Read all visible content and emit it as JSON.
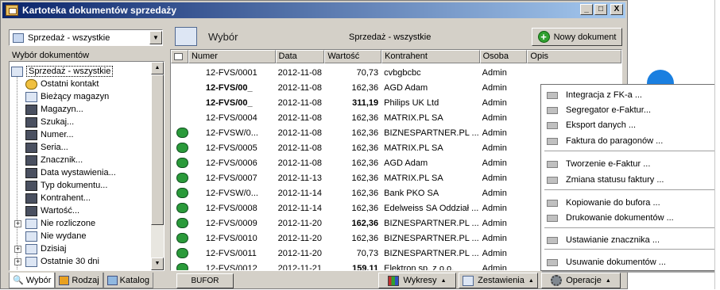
{
  "window": {
    "title": "Kartoteka dokumentów sprzedaży",
    "btn_min": "_",
    "btn_max": "□",
    "btn_close": "X"
  },
  "left": {
    "combo_value": "Sprzedaż - wszystkie",
    "section_label": "Wybór dokumentów",
    "tree": [
      {
        "label": "Sprzedaż - wszystkie",
        "icon": "list-icon",
        "selected": true
      },
      {
        "label": "Ostatni kontakt",
        "icon": "clock-icon"
      },
      {
        "label": "Bieżący magazyn",
        "icon": "list-icon"
      },
      {
        "label": "Magazyn...",
        "icon": "binoculars-icon"
      },
      {
        "label": "Szukaj...",
        "icon": "binoculars-icon"
      },
      {
        "label": "Numer...",
        "icon": "binoculars-icon"
      },
      {
        "label": "Seria...",
        "icon": "binoculars-icon"
      },
      {
        "label": "Znacznik...",
        "icon": "binoculars-icon"
      },
      {
        "label": "Data wystawienia...",
        "icon": "binoculars-icon"
      },
      {
        "label": "Typ dokumentu...",
        "icon": "binoculars-icon"
      },
      {
        "label": "Kontrahent...",
        "icon": "binoculars-icon"
      },
      {
        "label": "Wartość...",
        "icon": "binoculars-icon"
      },
      {
        "label": "Nie rozliczone",
        "icon": "list-icon",
        "expandable": true
      },
      {
        "label": "Nie wydane",
        "icon": "list-icon"
      },
      {
        "label": "Dzisiaj",
        "icon": "list-icon",
        "expandable": true
      },
      {
        "label": "Ostatnie 30 dni",
        "icon": "list-icon",
        "expandable": true
      }
    ],
    "tabs": [
      "Wybór",
      "Rodzaj",
      "Katalog"
    ]
  },
  "main": {
    "header_title": "Wybór",
    "context": "Sprzedaż - wszystkie",
    "new_doc": "Nowy dokument",
    "columns": [
      "Numer",
      "Data",
      "Wartość",
      "Kontrahent",
      "Osoba",
      "Opis"
    ],
    "rows": [
      {
        "numer": "12-FVS/0001",
        "data": "2012-11-08",
        "wartosc": "70,73",
        "kontrahent": "cvbgbcbc",
        "osoba": "Admin",
        "bold": false,
        "icon": false
      },
      {
        "numer": "12-FVS/00_",
        "data": "2012-11-08",
        "wartosc": "162,36",
        "kontrahent": "AGD Adam",
        "osoba": "Admin",
        "bold": true,
        "icon": false
      },
      {
        "numer": "12-FVS/00_",
        "data": "2012-11-08",
        "wartosc": "311,19",
        "kontrahent": "Philips UK Ltd",
        "osoba": "Admin",
        "bold": true,
        "icon": false
      },
      {
        "numer": "12-FVS/0004",
        "data": "2012-11-08",
        "wartosc": "162,36",
        "kontrahent": "MATRIX.PL SA",
        "osoba": "Admin",
        "bold": false,
        "icon": false
      },
      {
        "numer": "12-FVSW/0...",
        "data": "2012-11-08",
        "wartosc": "162,36",
        "kontrahent": "BIZNESPARTNER.PL ...",
        "osoba": "Admin",
        "bold": false,
        "icon": true
      },
      {
        "numer": "12-FVS/0005",
        "data": "2012-11-08",
        "wartosc": "162,36",
        "kontrahent": "MATRIX.PL SA",
        "osoba": "Admin",
        "bold": false,
        "icon": true
      },
      {
        "numer": "12-FVS/0006",
        "data": "2012-11-08",
        "wartosc": "162,36",
        "kontrahent": "AGD Adam",
        "osoba": "Admin",
        "bold": false,
        "icon": true
      },
      {
        "numer": "12-FVS/0007",
        "data": "2012-11-13",
        "wartosc": "162,36",
        "kontrahent": "MATRIX.PL SA",
        "osoba": "Admin",
        "bold": false,
        "icon": true
      },
      {
        "numer": "12-FVSW/0...",
        "data": "2012-11-14",
        "wartosc": "162,36",
        "kontrahent": "Bank PKO SA",
        "osoba": "Admin",
        "bold": false,
        "icon": true
      },
      {
        "numer": "12-FVS/0008",
        "data": "2012-11-14",
        "wartosc": "162,36",
        "kontrahent": "Edelweiss SA Oddział ...",
        "osoba": "Admin",
        "bold": false,
        "icon": true
      },
      {
        "numer": "12-FVS/0009",
        "data": "2012-11-20",
        "wartosc": "162,36",
        "kontrahent": "BIZNESPARTNER.PL ...",
        "osoba": "Admin",
        "bold": false,
        "icon": true,
        "bold_value": true
      },
      {
        "numer": "12-FVS/0010",
        "data": "2012-11-20",
        "wartosc": "162,36",
        "kontrahent": "BIZNESPARTNER.PL ...",
        "osoba": "Admin",
        "bold": false,
        "icon": true
      },
      {
        "numer": "12-FVS/0011",
        "data": "2012-11-20",
        "wartosc": "70,73",
        "kontrahent": "BIZNESPARTNER.PL ...",
        "osoba": "Admin",
        "bold": false,
        "icon": true
      },
      {
        "numer": "12-FVS/0012",
        "data": "2012-11-21",
        "wartosc": "159,11",
        "kontrahent": "Elektron sp. z o.o.",
        "osoba": "Admin",
        "bold": false,
        "icon": true,
        "bold_value": true
      }
    ]
  },
  "bottom": {
    "bufor": "BUFOR",
    "wykresy": "Wykresy",
    "zestawienia": "Zestawienia",
    "operacje": "Operacje"
  },
  "menu": {
    "items": [
      "Integracja z FK-a ...",
      "Segregator e-Faktur...",
      "Eksport danych ...",
      "Faktura do paragonów ...",
      "Tworzenie e-Faktur ...",
      "Zmiana statusu faktury ...",
      "Kopiowanie do bufora ...",
      "Drukowanie dokumentów ...",
      "Ustawianie znacznika ...",
      "Usuwanie dokumentów ..."
    ]
  }
}
